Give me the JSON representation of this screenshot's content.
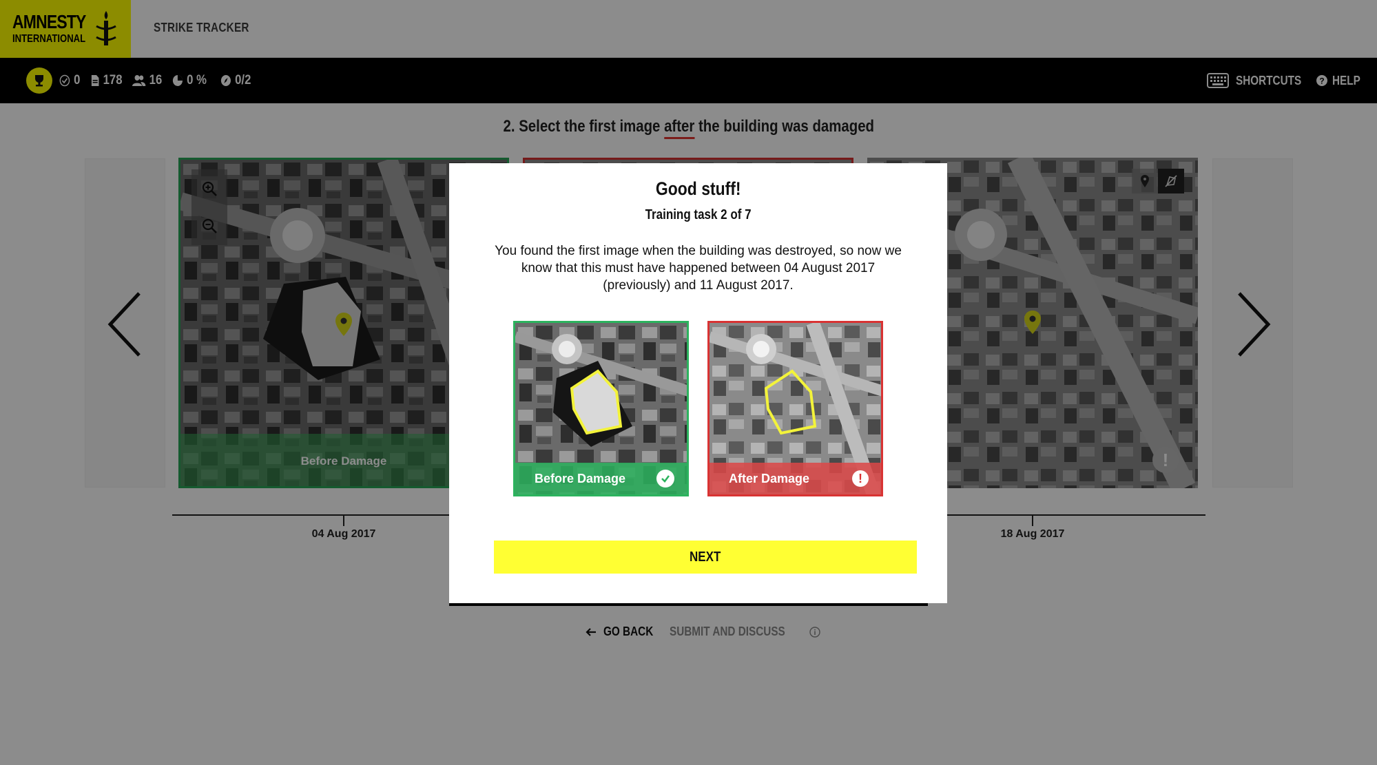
{
  "header": {
    "logo_line1": "AMNESTY",
    "logo_line2": "INTERNATIONAL",
    "app_title": "STRIKE TRACKER",
    "brand_color": "#ffff00"
  },
  "stats": {
    "verified": "0",
    "documents": "178",
    "users": "16",
    "progress": "0 %",
    "tasks": "0/2",
    "shortcuts_label": "SHORTCUTS",
    "help_label": "HELP"
  },
  "instruction": {
    "prefix": "2. Select the first image ",
    "emphasis": "after",
    "suffix": " the building was damaged"
  },
  "frames": [
    {
      "caption": "Before Damage",
      "date": "04 Aug 2017"
    },
    {
      "caption": "",
      "date": ""
    },
    {
      "caption": "",
      "date": "18 Aug 2017"
    }
  ],
  "actions": {
    "go_back": "GO BACK",
    "submit": "SUBMIT AND DISCUSS"
  },
  "modal": {
    "title": "Good stuff!",
    "subtitle": "Training task 2 of 7",
    "body": "You found the first image when the building was destroyed, so now we know that this must have happened between 04 August 2017 (previously) and 11 August 2017.",
    "before_label": "Before Damage",
    "after_label": "After Damage",
    "next_label": "NEXT"
  },
  "colors": {
    "before_green": "#2cb35e",
    "after_red": "#d93333",
    "accent_yellow": "#ffff33"
  }
}
